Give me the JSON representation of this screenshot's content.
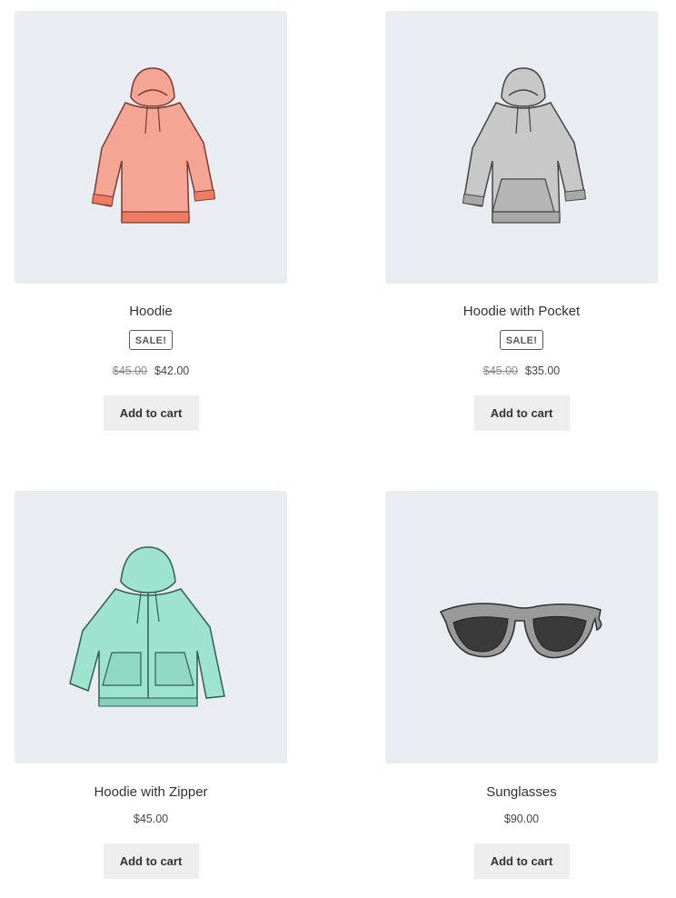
{
  "products": [
    {
      "title": "Hoodie",
      "sale_badge": "SALE!",
      "price_old": "$45.00",
      "price": "$42.00",
      "button": "Add to cart",
      "image_icon": "hoodie-icon",
      "color": "#f5a594"
    },
    {
      "title": "Hoodie with Pocket",
      "sale_badge": "SALE!",
      "price_old": "$45.00",
      "price": "$35.00",
      "button": "Add to cart",
      "image_icon": "hoodie-pocket-icon",
      "color": "#c8c8c8"
    },
    {
      "title": "Hoodie with Zipper",
      "price": "$45.00",
      "button": "Add to cart",
      "image_icon": "hoodie-zipper-icon",
      "color": "#9ee3cd"
    },
    {
      "title": "Sunglasses",
      "price": "$90.00",
      "button": "Add to cart",
      "image_icon": "sunglasses-icon",
      "color": "#9a9a9a"
    }
  ]
}
